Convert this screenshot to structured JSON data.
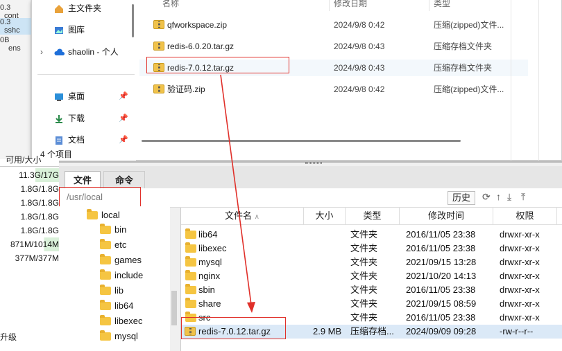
{
  "bg_window": {
    "lines": [
      "0.3",
      "0.3",
      "0B"
    ],
    "fragments": [
      "cont",
      "sshc",
      "ens"
    ]
  },
  "explorer": {
    "nav": [
      {
        "label": "主文件夹",
        "icon": "home-icon"
      },
      {
        "label": "图库",
        "icon": "gallery-icon"
      },
      {
        "label": "shaolin - 个人",
        "icon": "cloud-icon"
      },
      {
        "label": "桌面",
        "icon": "desktop-icon"
      },
      {
        "label": "下载",
        "icon": "download-icon"
      },
      {
        "label": "文档",
        "icon": "document-icon"
      }
    ],
    "status": "4 个项目",
    "columns": [
      "名称",
      "修改日期",
      "类型"
    ],
    "files": [
      {
        "name": "qfworkspace.zip",
        "date": "2024/9/8 0:42",
        "type": "压缩(zipped)文件..."
      },
      {
        "name": "redis-6.0.20.tar.gz",
        "date": "2024/9/8 0:43",
        "type": "压缩存档文件夹"
      },
      {
        "name": "redis-7.0.12.tar.gz",
        "date": "2024/9/8 0:43",
        "type": "压缩存档文件夹"
      },
      {
        "name": "验证码.zip",
        "date": "2024/9/8 0:42",
        "type": "压缩(zipped)文件..."
      }
    ]
  },
  "left_stats": {
    "header": "可用/大小",
    "values": [
      "11.3G/17G",
      "1.8G/1.8G",
      "1.8G/1.8G",
      "1.8G/1.8G",
      "1.8G/1.8G",
      "871M/1014M",
      "377M/377M"
    ],
    "footer": "升级"
  },
  "ssh": {
    "tabs": [
      "文件",
      "命令"
    ],
    "path": "/usr/local",
    "history_label": "历史",
    "tree": [
      "local",
      "bin",
      "etc",
      "games",
      "include",
      "lib",
      "lib64",
      "libexec",
      "mysql"
    ],
    "columns": [
      "文件名",
      "大小",
      "类型",
      "修改时间",
      "权限"
    ],
    "rows": [
      {
        "name": "lib64",
        "size": "",
        "type": "文件夹",
        "date": "2016/11/05 23:38",
        "perm": "drwxr-xr-x"
      },
      {
        "name": "libexec",
        "size": "",
        "type": "文件夹",
        "date": "2016/11/05 23:38",
        "perm": "drwxr-xr-x"
      },
      {
        "name": "mysql",
        "size": "",
        "type": "文件夹",
        "date": "2021/09/15 13:28",
        "perm": "drwxr-xr-x"
      },
      {
        "name": "nginx",
        "size": "",
        "type": "文件夹",
        "date": "2021/10/20 14:13",
        "perm": "drwxr-xr-x"
      },
      {
        "name": "sbin",
        "size": "",
        "type": "文件夹",
        "date": "2016/11/05 23:38",
        "perm": "drwxr-xr-x"
      },
      {
        "name": "share",
        "size": "",
        "type": "文件夹",
        "date": "2021/09/15 08:59",
        "perm": "drwxr-xr-x"
      },
      {
        "name": "src",
        "size": "",
        "type": "文件夹",
        "date": "2016/11/05 23:38",
        "perm": "drwxr-xr-x"
      },
      {
        "name": "redis-7.0.12.tar.gz",
        "size": "2.9 MB",
        "type": "压缩存档...",
        "date": "2024/09/09 09:28",
        "perm": "-rw-r--r--"
      }
    ]
  },
  "colors": {
    "annotation": "#e0302a",
    "selected_row": "#dbe9f7",
    "tab_active": "#ffffff"
  }
}
